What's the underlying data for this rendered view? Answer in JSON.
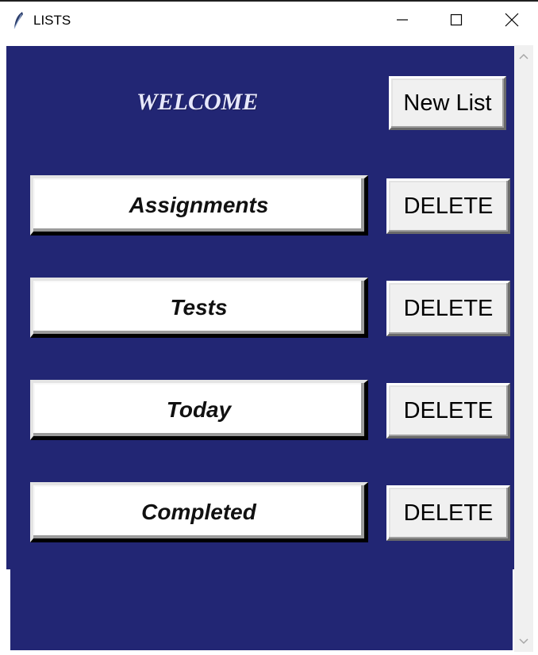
{
  "window": {
    "title": "LISTS"
  },
  "icons": {
    "app": "feather-icon",
    "minimize": "minimize-icon",
    "maximize": "maximize-icon",
    "close": "close-icon",
    "scroll_up": "chevron-up-icon",
    "scroll_down": "chevron-down-icon"
  },
  "colors": {
    "panel": "#222674",
    "button_face": "#f0f0f0",
    "list_button": "#ffffff"
  },
  "header": {
    "welcome": "WELCOME",
    "new_list_label": "New List"
  },
  "lists": [
    {
      "name": "Assignments",
      "delete_label": "DELETE"
    },
    {
      "name": "Tests",
      "delete_label": "DELETE"
    },
    {
      "name": "Today",
      "delete_label": "DELETE"
    },
    {
      "name": "Completed",
      "delete_label": "DELETE"
    }
  ]
}
